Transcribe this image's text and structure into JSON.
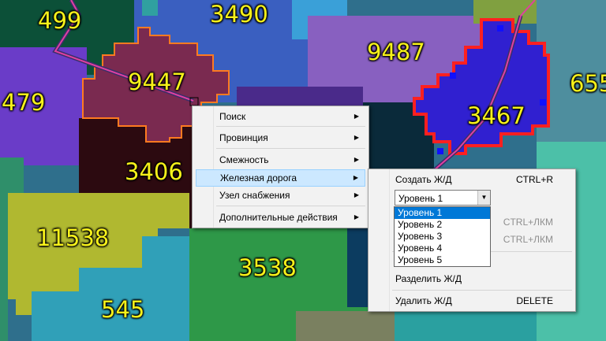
{
  "map": {
    "province_ids": [
      "499",
      "3490",
      "9487",
      "655",
      "479",
      "9447",
      "3467",
      "3406",
      "11538",
      "3538",
      "545"
    ],
    "railway_color": "#e040a0",
    "selection_outline_color": "#ff2020",
    "hover_outline_color": "#ff7a20"
  },
  "context_menu": {
    "items": [
      {
        "label": "Поиск",
        "submenu": true
      },
      {
        "label": "Провинция",
        "submenu": true
      },
      {
        "label": "Смежность",
        "submenu": true
      },
      {
        "label": "Железная дорога",
        "submenu": true,
        "highlighted": true
      },
      {
        "label": "Узел снабжения",
        "submenu": true
      },
      {
        "label": "Дополнительные действия",
        "submenu": true
      }
    ]
  },
  "railway_submenu": {
    "create": {
      "label": "Создать Ж/Д",
      "shortcut": "CTRL+R"
    },
    "level_select": {
      "value": "Уровень 1"
    },
    "hidden_shortcut_1": "CTRL+ЛКМ",
    "hidden_shortcut_2": "CTRL+ЛКМ",
    "split": {
      "label": "Разделить Ж/Д"
    },
    "delete": {
      "label": "Удалить Ж/Д",
      "shortcut": "DELETE"
    }
  },
  "level_dropdown": {
    "options": [
      "Уровень 1",
      "Уровень 2",
      "Уровень 3",
      "Уровень 4",
      "Уровень 5"
    ],
    "selected_index": 0
  }
}
